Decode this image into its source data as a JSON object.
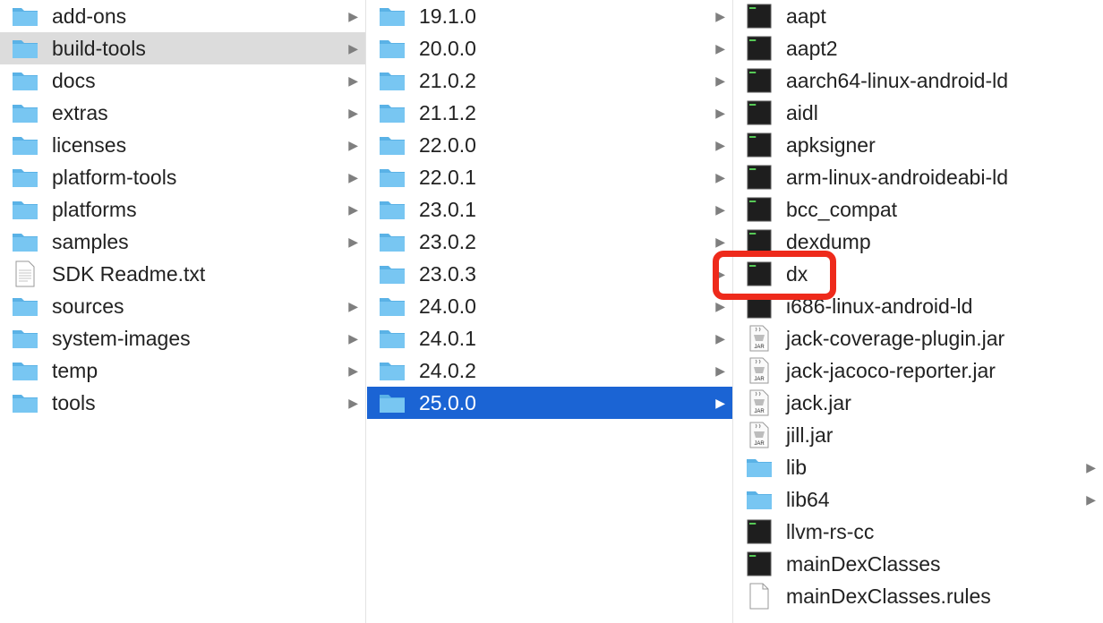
{
  "colors": {
    "selected_blue": "#1b64d4",
    "selected_gray": "#dcdcdc",
    "annotation_red": "#ee2a1b",
    "folder": "#6cbcea"
  },
  "column1": {
    "items": [
      {
        "label": "add-ons",
        "icon": "folder-icon",
        "has_children": true,
        "selected": false
      },
      {
        "label": "build-tools",
        "icon": "folder-icon",
        "has_children": true,
        "selected": true
      },
      {
        "label": "docs",
        "icon": "folder-icon",
        "has_children": true,
        "selected": false
      },
      {
        "label": "extras",
        "icon": "folder-icon",
        "has_children": true,
        "selected": false
      },
      {
        "label": "licenses",
        "icon": "folder-icon",
        "has_children": true,
        "selected": false
      },
      {
        "label": "platform-tools",
        "icon": "folder-icon",
        "has_children": true,
        "selected": false
      },
      {
        "label": "platforms",
        "icon": "folder-icon",
        "has_children": true,
        "selected": false
      },
      {
        "label": "samples",
        "icon": "folder-icon",
        "has_children": true,
        "selected": false
      },
      {
        "label": "SDK Readme.txt",
        "icon": "text-file-icon",
        "has_children": false,
        "selected": false
      },
      {
        "label": "sources",
        "icon": "folder-icon",
        "has_children": true,
        "selected": false
      },
      {
        "label": "system-images",
        "icon": "folder-icon",
        "has_children": true,
        "selected": false
      },
      {
        "label": "temp",
        "icon": "folder-icon",
        "has_children": true,
        "selected": false
      },
      {
        "label": "tools",
        "icon": "folder-icon",
        "has_children": true,
        "selected": false
      }
    ]
  },
  "column2": {
    "items": [
      {
        "label": "19.1.0",
        "icon": "folder-icon",
        "has_children": true,
        "selected": false
      },
      {
        "label": "20.0.0",
        "icon": "folder-icon",
        "has_children": true,
        "selected": false
      },
      {
        "label": "21.0.2",
        "icon": "folder-icon",
        "has_children": true,
        "selected": false
      },
      {
        "label": "21.1.2",
        "icon": "folder-icon",
        "has_children": true,
        "selected": false
      },
      {
        "label": "22.0.0",
        "icon": "folder-icon",
        "has_children": true,
        "selected": false
      },
      {
        "label": "22.0.1",
        "icon": "folder-icon",
        "has_children": true,
        "selected": false
      },
      {
        "label": "23.0.1",
        "icon": "folder-icon",
        "has_children": true,
        "selected": false
      },
      {
        "label": "23.0.2",
        "icon": "folder-icon",
        "has_children": true,
        "selected": false
      },
      {
        "label": "23.0.3",
        "icon": "folder-icon",
        "has_children": true,
        "selected": false
      },
      {
        "label": "24.0.0",
        "icon": "folder-icon",
        "has_children": true,
        "selected": false
      },
      {
        "label": "24.0.1",
        "icon": "folder-icon",
        "has_children": true,
        "selected": false
      },
      {
        "label": "24.0.2",
        "icon": "folder-icon",
        "has_children": true,
        "selected": false
      },
      {
        "label": "25.0.0",
        "icon": "folder-icon",
        "has_children": true,
        "selected": true
      }
    ]
  },
  "column3": {
    "items": [
      {
        "label": "aapt",
        "icon": "terminal-exec-icon",
        "has_children": false
      },
      {
        "label": "aapt2",
        "icon": "terminal-exec-icon",
        "has_children": false
      },
      {
        "label": "aarch64-linux-android-ld",
        "icon": "terminal-exec-icon",
        "has_children": false
      },
      {
        "label": "aidl",
        "icon": "terminal-exec-icon",
        "has_children": false
      },
      {
        "label": "apksigner",
        "icon": "terminal-exec-icon",
        "has_children": false
      },
      {
        "label": "arm-linux-androideabi-ld",
        "icon": "terminal-exec-icon",
        "has_children": false
      },
      {
        "label": "bcc_compat",
        "icon": "terminal-exec-icon",
        "has_children": false
      },
      {
        "label": "dexdump",
        "icon": "terminal-exec-icon",
        "has_children": false
      },
      {
        "label": "dx",
        "icon": "terminal-exec-icon",
        "has_children": false
      },
      {
        "label": "i686-linux-android-ld",
        "icon": "terminal-exec-icon",
        "has_children": false
      },
      {
        "label": "jack-coverage-plugin.jar",
        "icon": "jar-file-icon",
        "has_children": false
      },
      {
        "label": "jack-jacoco-reporter.jar",
        "icon": "jar-file-icon",
        "has_children": false
      },
      {
        "label": "jack.jar",
        "icon": "jar-file-icon",
        "has_children": false
      },
      {
        "label": "jill.jar",
        "icon": "jar-file-icon",
        "has_children": false
      },
      {
        "label": "lib",
        "icon": "folder-icon",
        "has_children": true
      },
      {
        "label": "lib64",
        "icon": "folder-icon",
        "has_children": true
      },
      {
        "label": "llvm-rs-cc",
        "icon": "terminal-exec-icon",
        "has_children": false
      },
      {
        "label": "mainDexClasses",
        "icon": "terminal-exec-icon",
        "has_children": false
      },
      {
        "label": "mainDexClasses.rules",
        "icon": "blank-file-icon",
        "has_children": false
      }
    ]
  },
  "jar_badge": "JAR",
  "exec_badge": "exec",
  "highlight": {
    "target": "dx"
  }
}
